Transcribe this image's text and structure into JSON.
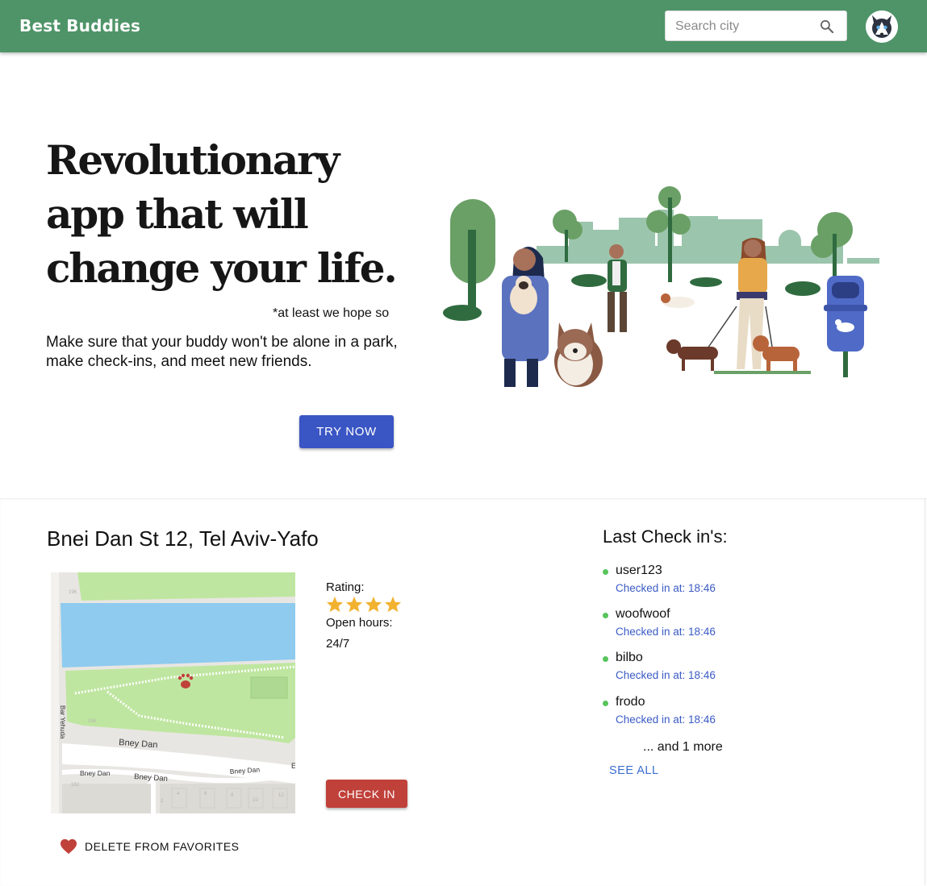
{
  "header": {
    "brand": "Best Buddies",
    "search_placeholder": "Search city"
  },
  "hero": {
    "title": "Revolutionary app that will change your life.",
    "note": "*at least we hope so",
    "description": "Make sure that your buddy won't be alone in a park, make check-ins, and meet new friends.",
    "cta_label": "TRY NOW"
  },
  "place": {
    "address": "Bnei Dan St 12, Tel Aviv-Yafo",
    "rating_label": "Rating:",
    "rating": 4,
    "rating_max": 4,
    "hours_label": "Open hours:",
    "hours_value": "24/7",
    "checkin_label": "CHECK IN",
    "favorite_label": "DELETE FROM FAVORITES",
    "map_labels": {
      "street_main": "Bney Dan",
      "street_left": "Bney Dan",
      "street_mid": "Bney Dan",
      "street_right": "Bney Dan",
      "street_vertical": "Bar Yehuda",
      "number_196a": "196",
      "number_196b": "196",
      "number_192": "192",
      "number_2": "2",
      "number_4": "4",
      "number_6": "6",
      "number_8": "8",
      "number_10": "10",
      "number_12": "12",
      "number_e": "E"
    }
  },
  "checkins": {
    "title": "Last Check in's:",
    "items": [
      {
        "user": "user123",
        "time": "Checked in at: 18:46"
      },
      {
        "user": "woofwoof",
        "time": "Checked in at: 18:46"
      },
      {
        "user": "bilbo",
        "time": "Checked in at: 18:46"
      },
      {
        "user": "frodo",
        "time": "Checked in at: 18:46"
      }
    ],
    "more": "... and 1 more",
    "see_all": "SEE ALL"
  },
  "colors": {
    "appbar": "#4f9468",
    "primary_button": "#3a55c4",
    "checkin_button": "#c0413a",
    "online_dot": "#57c45c",
    "link": "#3a5bc4"
  }
}
